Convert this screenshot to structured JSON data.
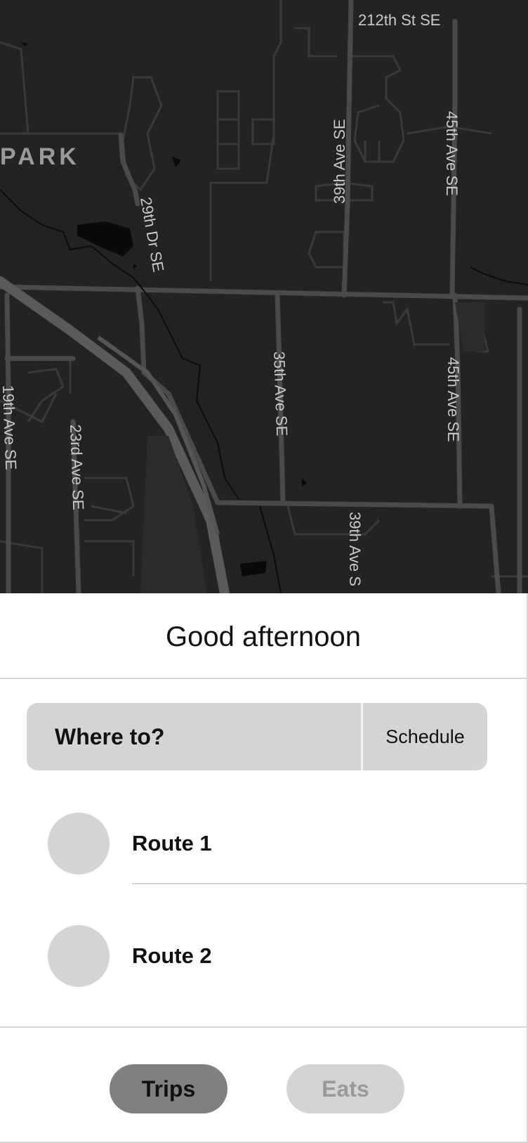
{
  "map": {
    "area_label": "PARK",
    "street_labels": {
      "street_212th": "212th St SE",
      "ave_39th_north": "39th Ave SE",
      "ave_45th_north": "45th Ave SE",
      "dr_29th": "29th Dr SE",
      "ave_35th": "35th Ave SE",
      "ave_45th_south": "45th Ave SE",
      "ave_19th": "19th Ave SE",
      "ave_23rd": "23rd Ave SE",
      "ave_39th_south": "39th Ave S"
    }
  },
  "sheet": {
    "greeting": "Good afternoon",
    "search": {
      "label": "Where to?",
      "schedule_label": "Schedule"
    },
    "routes": [
      {
        "label": "Route 1"
      },
      {
        "label": "Route 2"
      }
    ]
  },
  "tabs": [
    {
      "label": "Trips",
      "selected": true
    },
    {
      "label": "Eats",
      "selected": false
    }
  ],
  "colors": {
    "map_background": "#232323",
    "map_roads": "#4a4a4a",
    "placeholder_gray": "#d4d4d4",
    "active_tab": "#808080",
    "inactive_tab_text": "#9a9a9a"
  }
}
